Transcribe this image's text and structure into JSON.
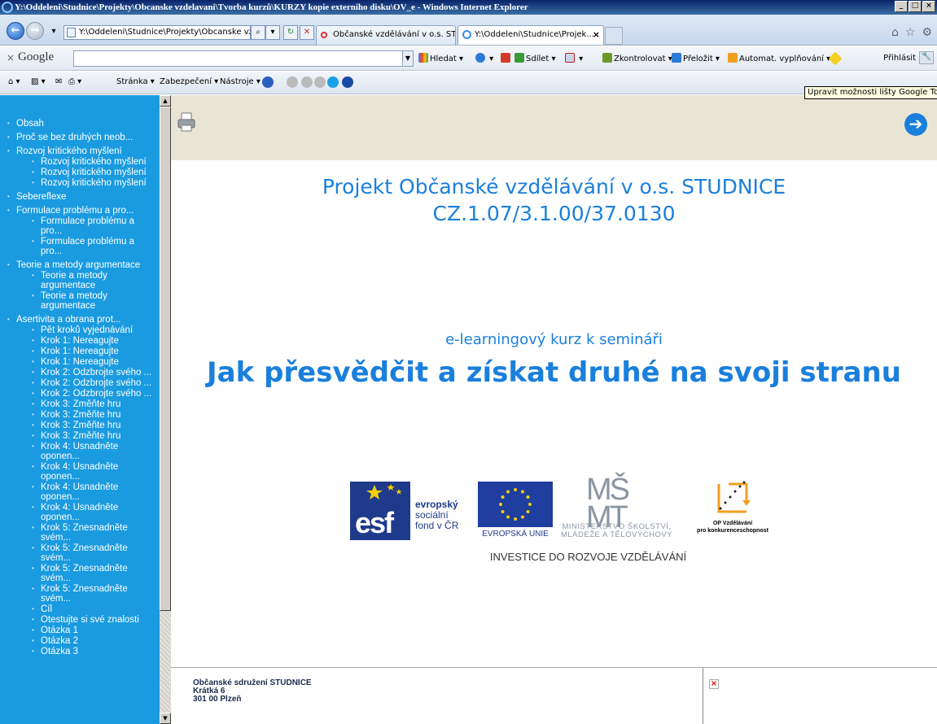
{
  "window": {
    "title": "Y:\\Oddeleni\\Studnice\\Projekty\\Obcanske vzdelavani\\Tvorba kurzů\\KURZY kopie externiho disku\\OV_e - Windows Internet Explorer",
    "controls": [
      "_",
      "□",
      "×"
    ]
  },
  "nav": {
    "address": "Y:\\Oddeleni\\Studnice\\Projekty\\Obcanske vzde",
    "tabs": [
      {
        "label": "Občanské vzdělávání v o.s. STU...",
        "icon": "studnice-icon"
      },
      {
        "label": "Y:\\Oddeleni\\Studnice\\Projek...",
        "icon": "ie-icon",
        "close": "×"
      }
    ]
  },
  "google_toolbar": {
    "close": "×",
    "logo": "Google",
    "search": "Hledat",
    "share": "Sdílet",
    "check": "Zkontrolovat",
    "translate": "Přeložit",
    "autofill": "Automat. vyplňování",
    "signin": "Přihlásit",
    "tooltip": "Upravit možnosti lišty Google Toolbar"
  },
  "command_bar": {
    "page": "Stránka",
    "security": "Zabezpečení",
    "tools": "Nástroje"
  },
  "toc": [
    {
      "level": 1,
      "label": "Obsah"
    },
    {
      "level": 1,
      "label": "Proč se bez druhých neob..."
    },
    {
      "level": 1,
      "label": "Rozvoj kritického myšlení"
    },
    {
      "level": 2,
      "label": "Rozvoj kritického myšlení"
    },
    {
      "level": 2,
      "label": "Rozvoj kritického myšlení"
    },
    {
      "level": 2,
      "label": "Rozvoj kritického myšlení"
    },
    {
      "level": 1,
      "label": "Sebereflexe"
    },
    {
      "level": 1,
      "label": "Formulace problému a pro..."
    },
    {
      "level": 2,
      "label": "Formulace problému a pro..."
    },
    {
      "level": 2,
      "label": "Formulace problému a pro..."
    },
    {
      "level": 1,
      "label": "Teorie a metody argumentace"
    },
    {
      "level": 2,
      "label": "Teorie a metody argumentace"
    },
    {
      "level": 2,
      "label": "Teorie a metody argumentace"
    },
    {
      "level": 1,
      "label": "Asertivita a obrana prot..."
    },
    {
      "level": 2,
      "label": "Pět kroků vyjednávání"
    },
    {
      "level": 2,
      "label": "Krok 1: Nereagujte"
    },
    {
      "level": 2,
      "label": "Krok 1: Nereagujte"
    },
    {
      "level": 2,
      "label": "Krok 1: Nereagujte"
    },
    {
      "level": 2,
      "label": "Krok 2: Odzbrojte svého ..."
    },
    {
      "level": 2,
      "label": "Krok 2: Odzbrojte svého ..."
    },
    {
      "level": 2,
      "label": "Krok 2: Odzbrojte svého ..."
    },
    {
      "level": 2,
      "label": "Krok 3: Změňte hru"
    },
    {
      "level": 2,
      "label": "Krok 3: Změňte hru"
    },
    {
      "level": 2,
      "label": "Krok 3: Změňte hru"
    },
    {
      "level": 2,
      "label": "Krok 3: Změňte hru"
    },
    {
      "level": 2,
      "label": "Krok 4: Usnadněte oponen..."
    },
    {
      "level": 2,
      "label": "Krok 4: Usnadněte oponen..."
    },
    {
      "level": 2,
      "label": "Krok 4: Usnadněte oponen..."
    },
    {
      "level": 2,
      "label": "Krok 4: Usnadněte oponen..."
    },
    {
      "level": 2,
      "label": "Krok 5: Znesnadněte svém..."
    },
    {
      "level": 2,
      "label": "Krok 5: Znesnadněte svém..."
    },
    {
      "level": 2,
      "label": "Krok 5: Znesnadněte svém..."
    },
    {
      "level": 2,
      "label": "Krok 5: Znesnadněte svém..."
    },
    {
      "level": 2,
      "label": "Cíl"
    },
    {
      "level": 2,
      "label": "Otestujte si své znalosti"
    },
    {
      "level": 2,
      "label": "Otázka 1"
    },
    {
      "level": 2,
      "label": "Otázka 2"
    },
    {
      "level": 2,
      "label": "Otázka 3"
    }
  ],
  "content": {
    "project_title_line1": "Projekt Občanské vzdělávání v o.s. STUDNICE",
    "project_title_line2": "CZ.1.07/3.1.00/37.0130",
    "subtitle": "e-learningový kurz k semináři",
    "course_title": "Jak přesvědčit a získat druhé na svoji stranu",
    "esf": {
      "mark": "esf",
      "line1": "evropský",
      "line2": "sociální",
      "line3": "fond v ČR"
    },
    "eu": "EVROPSKÁ UNIE",
    "msmt": {
      "line1": "MINISTERSTVO ŠKOLSTVÍ,",
      "line2": "MLÁDEŽE A TĚLOVÝCHOVY"
    },
    "op": {
      "line1": "OP Vzdělávání",
      "line2": "pro konkurenceschopnost"
    },
    "investice": "INVESTICE DO ROZVOJE VZDĚLÁVÁNÍ"
  },
  "footer": {
    "org": "Občanské sdružení STUDNICE",
    "street": "Krátká 6",
    "city": "301 00 Plzeň",
    "broken": "×"
  },
  "colors": {
    "accent": "#1a7fdc",
    "sidebar": "#1a9be0",
    "header_band": "#e9e5d5"
  }
}
